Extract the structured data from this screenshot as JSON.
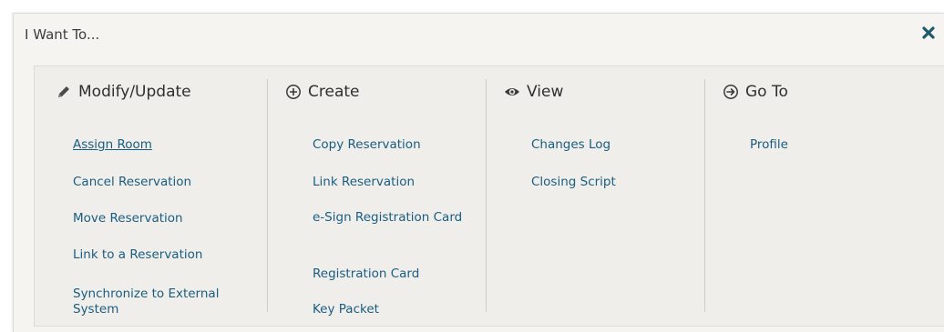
{
  "panel": {
    "title": "I Want To..."
  },
  "columns": [
    {
      "heading": "Modify/Update",
      "icon": "pencil-icon",
      "items": [
        "Assign Room",
        "Cancel Reservation",
        "Move Reservation",
        "Link to a Reservation",
        "Synchronize to External System"
      ]
    },
    {
      "heading": "Create",
      "icon": "plus-circle-icon",
      "items": [
        "Copy Reservation",
        "Link Reservation",
        "e-Sign Registration Card",
        "Registration Card",
        "Key Packet"
      ]
    },
    {
      "heading": "View",
      "icon": "eye-icon",
      "items": [
        "Changes Log",
        "Closing Script"
      ]
    },
    {
      "heading": "Go To",
      "icon": "arrow-right-circle-icon",
      "items": [
        "Profile"
      ]
    }
  ],
  "colors": {
    "link": "#1a5d80",
    "close": "#1e5a6e"
  }
}
